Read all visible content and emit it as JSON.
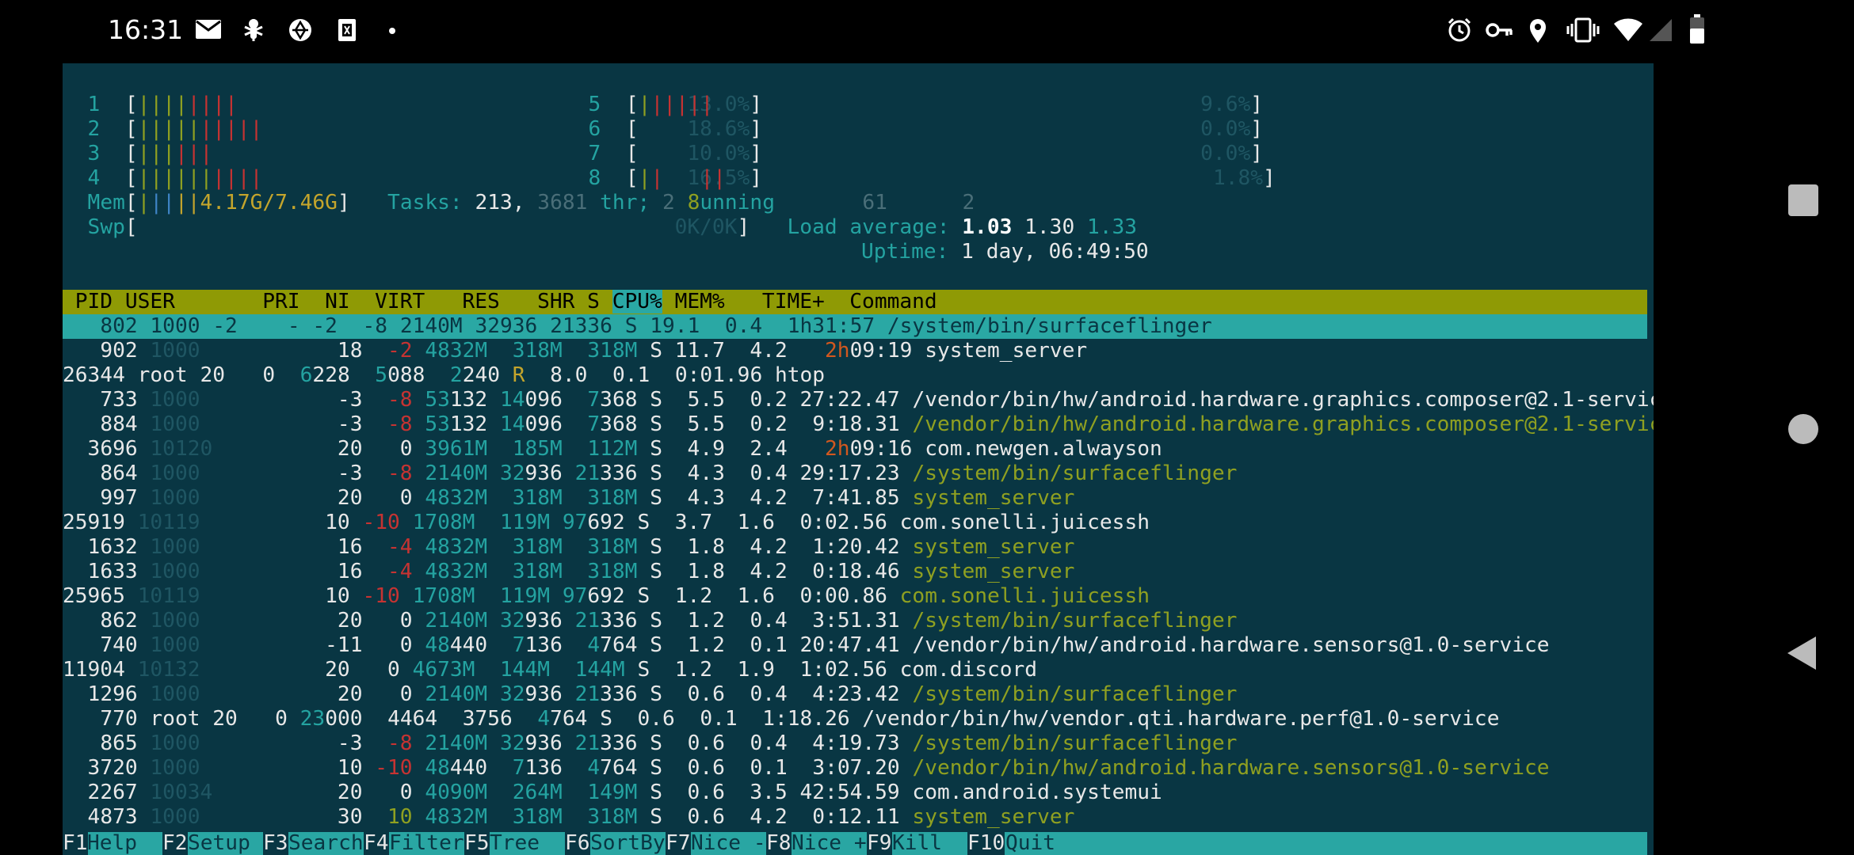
{
  "status_bar": {
    "time": "16:31",
    "left_icons": [
      "mail-icon",
      "bug-icon",
      "pinwheel-icon",
      "sim-card-icon",
      "dot-icon"
    ],
    "right_icons": [
      "alarm-icon",
      "key-icon",
      "location-icon",
      "vibrate-icon",
      "wifi-icon",
      "signal-icon",
      "battery-icon"
    ]
  },
  "meters": {
    "cpus": [
      {
        "id": "1",
        "bars": "||||||||",
        "pct": "13.0%"
      },
      {
        "id": "2",
        "bars": "||||||||||",
        "pct": "18.6%"
      },
      {
        "id": "3",
        "bars": "||||||",
        "pct": "10.0%"
      },
      {
        "id": "4",
        "bars": "||||||||||",
        "pct": "16.5%"
      },
      {
        "id": "5",
        "bars": "||||||",
        "pct": "9.6%"
      },
      {
        "id": "6",
        "bars": "",
        "pct": "0.0%"
      },
      {
        "id": "7",
        "bars": "",
        "pct": "0.0%"
      },
      {
        "id": "8",
        "bars": "||  ||",
        "pct": "1.8%"
      }
    ],
    "mem_label": "Mem",
    "mem_value": "4.17G/7.46G",
    "swp_label": "Swp",
    "swp_value": "0K/0K",
    "tasks_label": "Tasks:",
    "tasks": "213,",
    "threads": "3681",
    "thr_label": "thr;",
    "running": "2",
    "running_text": "8unning",
    "overlay_a": "61",
    "overlay_b": "2",
    "load_label": "Load average:",
    "load_1": "1.03",
    "load_5": "1.30",
    "load_15": "1.33",
    "uptime_label": "Uptime:",
    "uptime": "1 day, 06:49:50"
  },
  "columns": {
    "header_text": " PID USER       PRI  NI  VIRT   RES   SHR S ",
    "cpu_col": "CPU%",
    "rest_text": " MEM%   TIME+  Command"
  },
  "processes": [
    {
      "pid": "802",
      "user": "1000 -2",
      "pri": "- -2",
      "ni": "-8",
      "virt": "2140M",
      "res": "32936",
      "shr": "21336",
      "s": "S",
      "cpu": "19.1",
      "mem": "0.4",
      "time": "1h31:57",
      "cmd": "/system/bin/surfaceflinger"
    },
    {
      "pid": "902",
      "user": "1000",
      "pri": "18",
      "ni": "-2",
      "virt": "4832M",
      "res": "318M",
      "shr": "318M",
      "s": "S",
      "cpu": "11.7",
      "mem": "4.2",
      "time_h": "2h",
      "time": "09:19",
      "cmd": "system_server"
    },
    {
      "pid": "26344",
      "user": "root 20",
      "pri": "0",
      "ni": "6228",
      "virt": "5088",
      "res": "2240",
      "shr": "R",
      "s": "8.0",
      "cpu": "0.1",
      "mem": "0:01.96",
      "time": "htop",
      "cmd": ""
    },
    {
      "pid": "733",
      "user": "1000",
      "pri": "-3",
      "ni": "-8",
      "virt": "53132",
      "res": "14096",
      "shr": "7368",
      "s": "S",
      "cpu": "5.5",
      "mem": "0.2",
      "time": "27:22.47",
      "cmd": "/vendor/bin/hw/android.hardware.graphics.composer@2.1-service"
    },
    {
      "pid": "884",
      "user": "1000",
      "pri": "-3",
      "ni": "-8",
      "virt": "53132",
      "res": "14096",
      "shr": "7368",
      "s": "S",
      "cpu": "5.5",
      "mem": "0.2",
      "time": "9:18.31",
      "cmd": "/vendor/bin/hw/android.hardware.graphics.composer@2.1-service"
    },
    {
      "pid": "3696",
      "user": "10120",
      "pri": "20",
      "ni": "0",
      "virt": "3961M",
      "res": "185M",
      "shr": "112M",
      "s": "S",
      "cpu": "4.9",
      "mem": "2.4",
      "time_h": "2h",
      "time": "09:16",
      "cmd": "com.newgen.alwayson"
    },
    {
      "pid": "864",
      "user": "1000",
      "pri": "-3",
      "ni": "-8",
      "virt": "2140M",
      "res": "32936",
      "shr": "21336",
      "s": "S",
      "cpu": "4.3",
      "mem": "0.4",
      "time": "29:17.23",
      "cmd": "/system/bin/surfaceflinger"
    },
    {
      "pid": "997",
      "user": "1000",
      "pri": "20",
      "ni": "0",
      "virt": "4832M",
      "res": "318M",
      "shr": "318M",
      "s": "S",
      "cpu": "4.3",
      "mem": "4.2",
      "time": "7:41.85",
      "cmd": "system_server"
    },
    {
      "pid": "25919",
      "user": "10119",
      "pri": "10",
      "ni": "-10",
      "virt": "1708M",
      "res": "119M",
      "shr": "97692",
      "s": "S",
      "cpu": "3.7",
      "mem": "1.6",
      "time": "0:02.56",
      "cmd": "com.sonelli.juicessh"
    },
    {
      "pid": "1632",
      "user": "1000",
      "pri": "16",
      "ni": "-4",
      "virt": "4832M",
      "res": "318M",
      "shr": "318M",
      "s": "S",
      "cpu": "1.8",
      "mem": "4.2",
      "time": "1:20.42",
      "cmd": "system_server"
    },
    {
      "pid": "1633",
      "user": "1000",
      "pri": "16",
      "ni": "-4",
      "virt": "4832M",
      "res": "318M",
      "shr": "318M",
      "s": "S",
      "cpu": "1.8",
      "mem": "4.2",
      "time": "0:18.46",
      "cmd": "system_server"
    },
    {
      "pid": "25965",
      "user": "10119",
      "pri": "10",
      "ni": "-10",
      "virt": "1708M",
      "res": "119M",
      "shr": "97692",
      "s": "S",
      "cpu": "1.2",
      "mem": "1.6",
      "time": "0:00.86",
      "cmd": "com.sonelli.juicessh"
    },
    {
      "pid": "862",
      "user": "1000",
      "pri": "20",
      "ni": "0",
      "virt": "2140M",
      "res": "32936",
      "shr": "21336",
      "s": "S",
      "cpu": "1.2",
      "mem": "0.4",
      "time": "3:51.31",
      "cmd": "/system/bin/surfaceflinger"
    },
    {
      "pid": "740",
      "user": "1000",
      "pri": "-11",
      "ni": "0",
      "virt": "48440",
      "res": "7136",
      "shr": "4764",
      "s": "S",
      "cpu": "1.2",
      "mem": "0.1",
      "time": "20:47.41",
      "cmd": "/vendor/bin/hw/android.hardware.sensors@1.0-service"
    },
    {
      "pid": "11904",
      "user": "10132",
      "pri": "20",
      "ni": "0",
      "virt": "4673M",
      "res": "144M",
      "shr": "144M",
      "s": "S",
      "cpu": "1.2",
      "mem": "1.9",
      "time": "1:02.56",
      "cmd": "com.discord"
    },
    {
      "pid": "1296",
      "user": "1000",
      "pri": "20",
      "ni": "0",
      "virt": "2140M",
      "res": "32936",
      "shr": "21336",
      "s": "S",
      "cpu": "0.6",
      "mem": "0.4",
      "time": "4:23.42",
      "cmd": "/system/bin/surfaceflinger"
    },
    {
      "pid": "770",
      "user": "root 20",
      "pri": "0",
      "ni": "23000",
      "virt": "4464",
      "res": "3756",
      "shr": "4764",
      "s": "S",
      "cpu": "0.6",
      "mem": "0.1",
      "time": "1:18.26",
      "cmd": "/vendor/bin/hw/vendor.qti.hardware.perf@1.0-service"
    },
    {
      "pid": "865",
      "user": "1000",
      "pri": "-3",
      "ni": "-8",
      "virt": "2140M",
      "res": "32936",
      "shr": "21336",
      "s": "S",
      "cpu": "0.6",
      "mem": "0.4",
      "time": "4:19.73",
      "cmd": "/system/bin/surfaceflinger"
    },
    {
      "pid": "3720",
      "user": "1000",
      "pri": "10",
      "ni": "-10",
      "virt": "48440",
      "res": "7136",
      "shr": "4764",
      "s": "S",
      "cpu": "0.6",
      "mem": "0.1",
      "time": "3:07.20",
      "cmd": "/vendor/bin/hw/android.hardware.sensors@1.0-service"
    },
    {
      "pid": "2267",
      "user": "10034",
      "pri": "20",
      "ni": "0",
      "virt": "4090M",
      "res": "264M",
      "shr": "149M",
      "s": "S",
      "cpu": "0.6",
      "mem": "3.5",
      "time": "42:54.59",
      "cmd": "com.android.systemui"
    },
    {
      "pid": "4873",
      "user": "1000",
      "pri": "30",
      "ni": "10",
      "virt": "4832M",
      "res": "318M",
      "shr": "318M",
      "s": "S",
      "cpu": "0.6",
      "mem": "4.2",
      "time": "0:12.11",
      "cmd": "system_server"
    }
  ],
  "function_keys": [
    {
      "key": "F1",
      "label": "Help  "
    },
    {
      "key": "F2",
      "label": "Setup "
    },
    {
      "key": "F3",
      "label": "Search"
    },
    {
      "key": "F4",
      "label": "Filter"
    },
    {
      "key": "F5",
      "label": "Tree  "
    },
    {
      "key": "F6",
      "label": "SortBy"
    },
    {
      "key": "F7",
      "label": "Nice -"
    },
    {
      "key": "F8",
      "label": "Nice +"
    },
    {
      "key": "F9",
      "label": "Kill  "
    },
    {
      "key": "F10",
      "label": "Quit"
    }
  ],
  "nav_icons": [
    "recents-icon",
    "home-icon",
    "back-icon"
  ]
}
